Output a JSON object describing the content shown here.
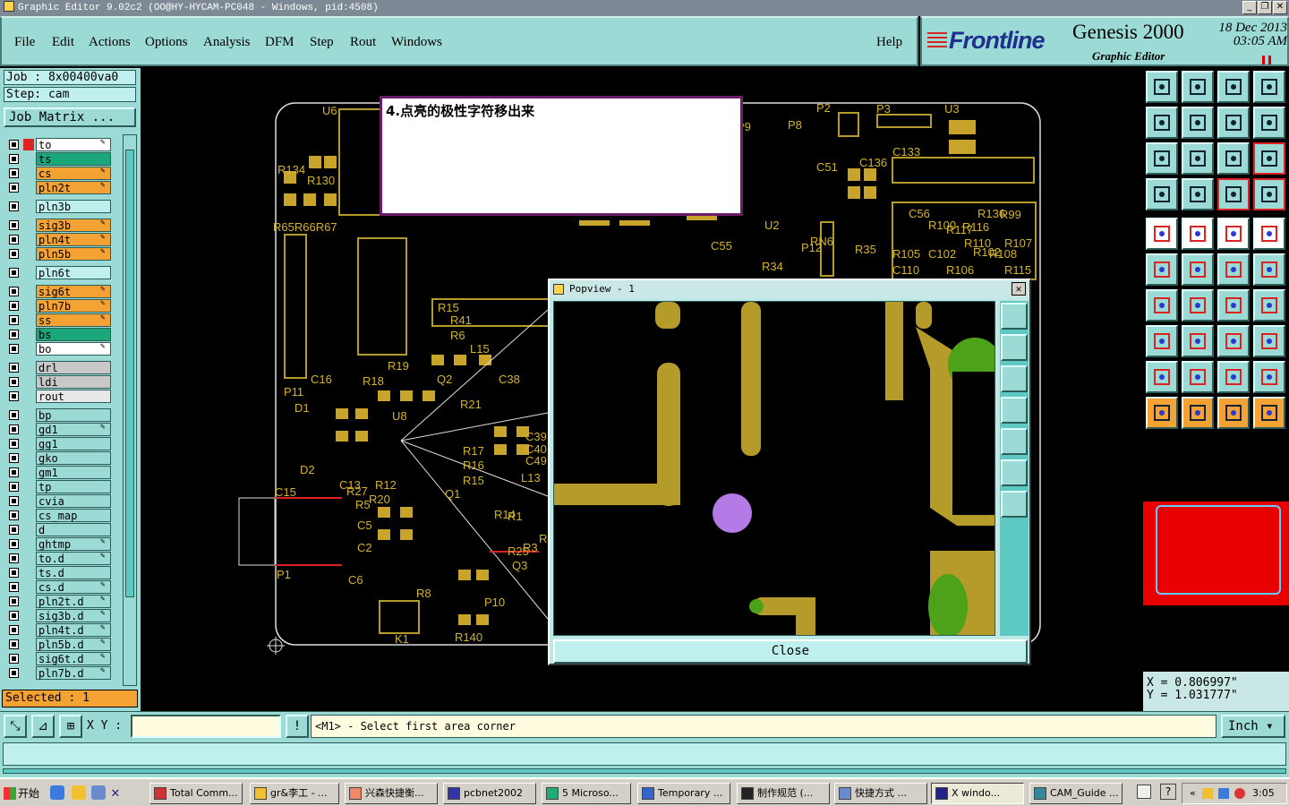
{
  "window": {
    "title": "Graphic Editor 9.02c2 (OO@HY-HYCAM-PC048 - Windows, pid:4508)",
    "controls": [
      "_",
      "❐",
      "✕"
    ]
  },
  "menu": [
    "File",
    "Edit",
    "Actions",
    "Options",
    "Analysis",
    "DFM",
    "Step",
    "Rout",
    "Windows",
    "Help"
  ],
  "brand": {
    "logo": "Frontline",
    "product": "Genesis 2000",
    "subtitle": "Graphic Editor",
    "date": "18 Dec 2013",
    "time": "03:05 AM"
  },
  "job": {
    "job_label": "Job : 8x00400va0",
    "step_label": "Step: cam",
    "matrix_button": "Job Matrix ..."
  },
  "layers": [
    {
      "name": "to",
      "color": "#ffffff",
      "editable": true,
      "active": true
    },
    {
      "name": "ts",
      "color": "#1aa87a"
    },
    {
      "name": "cs",
      "color": "#f4a234",
      "editable": true
    },
    {
      "name": "pln2t",
      "color": "#f4a234",
      "editable": true
    },
    {
      "name": "pln3b",
      "color": "#bff0ee"
    },
    {
      "name": "sig3b",
      "color": "#f4a234",
      "editable": true
    },
    {
      "name": "pln4t",
      "color": "#f4a234",
      "editable": true
    },
    {
      "name": "pln5b",
      "color": "#f4a234",
      "editable": true
    },
    {
      "name": "pln6t",
      "color": "#bff0ee"
    },
    {
      "name": "sig6t",
      "color": "#f4a234",
      "editable": true
    },
    {
      "name": "pln7b",
      "color": "#f4a234",
      "editable": true
    },
    {
      "name": "ss",
      "color": "#f4a234",
      "editable": true
    },
    {
      "name": "bs",
      "color": "#1aa87a"
    },
    {
      "name": "bo",
      "color": "#ffffff",
      "editable": true
    },
    {
      "name": "drl",
      "color": "#c8c8c8"
    },
    {
      "name": "ldi",
      "color": "#c8c8c8"
    },
    {
      "name": "rout",
      "color": "#e8e8e8"
    },
    {
      "name": "bp",
      "color": "#9bdad5"
    },
    {
      "name": "gd1",
      "color": "#9bdad5",
      "editable": true
    },
    {
      "name": "gg1",
      "color": "#9bdad5"
    },
    {
      "name": "gko",
      "color": "#9bdad5"
    },
    {
      "name": "gm1",
      "color": "#9bdad5"
    },
    {
      "name": "tp",
      "color": "#9bdad5"
    },
    {
      "name": "cvia",
      "color": "#9bdad5"
    },
    {
      "name": "cs_map",
      "color": "#9bdad5"
    },
    {
      "name": "d",
      "color": "#9bdad5"
    },
    {
      "name": "ghtmp",
      "color": "#9bdad5",
      "editable": true
    },
    {
      "name": "to.d",
      "color": "#9bdad5",
      "editable": true
    },
    {
      "name": "ts.d",
      "color": "#9bdad5"
    },
    {
      "name": "cs.d",
      "color": "#9bdad5",
      "editable": true
    },
    {
      "name": "pln2t.d",
      "color": "#9bdad5",
      "editable": true
    },
    {
      "name": "sig3b.d",
      "color": "#9bdad5",
      "editable": true
    },
    {
      "name": "pln4t.d",
      "color": "#9bdad5",
      "editable": true
    },
    {
      "name": "pln5b.d",
      "color": "#9bdad5",
      "editable": true
    },
    {
      "name": "sig6t.d",
      "color": "#9bdad5",
      "editable": true
    },
    {
      "name": "pln7b.d",
      "color": "#9bdad5",
      "editable": true
    }
  ],
  "selected": "Selected : 1",
  "annotation": "4.点亮的极性字符移出来",
  "board_labels": [
    "U6",
    "R134",
    "R130",
    "R65R66R67",
    "P11",
    "D1",
    "C16",
    "R18",
    "R19",
    "U8",
    "R21",
    "Q2",
    "R17",
    "R16",
    "R15",
    "Q1",
    "R14",
    "R1",
    "R139",
    "R3",
    "Q3",
    "R25",
    "R20",
    "C13",
    "R27",
    "R12",
    "R5",
    "C5",
    "C2",
    "C6",
    "R8",
    "P10",
    "R140",
    "K1",
    "P1",
    "C15",
    "D2",
    "R41",
    "R6",
    "R15",
    "L15",
    "C38",
    "C39",
    "C40",
    "C49",
    "L13",
    "P2",
    "P3",
    "U3",
    "P8",
    "C51",
    "C136",
    "C133",
    "P9",
    "U2",
    "RN6",
    "P12",
    "C55",
    "R34",
    "R35",
    "C56",
    "R136",
    "R99",
    "R100",
    "R117",
    "R116",
    "R110",
    "R102",
    "R108",
    "R107",
    "R105",
    "C102",
    "C110",
    "R106",
    "R115",
    "L19",
    "R101"
  ],
  "popview": {
    "title": "Popview - 1",
    "close_label": "Close"
  },
  "coords": {
    "x": "X = 0.806997\"",
    "y": "Y = 1.031777\""
  },
  "command": {
    "xy_label": "X Y :",
    "prompt": "<M1> - Select first area corner",
    "units": "Inch"
  },
  "taskbar": {
    "start": "开始",
    "tasks": [
      "Total Comm...",
      "gr&李工 - ...",
      "兴森快捷衡...",
      "pcbnet2002",
      "5 Microso...",
      "Temporary ...",
      "制作规范 (...",
      "快捷方式 ...",
      "X windo...",
      "CAM_Guide ..."
    ],
    "clock": "3:05"
  },
  "colors": {
    "panel": "#9bdad5",
    "copper": "#b59b2a",
    "silkscreen": "#d4b32a",
    "accent": "#f4a234"
  }
}
